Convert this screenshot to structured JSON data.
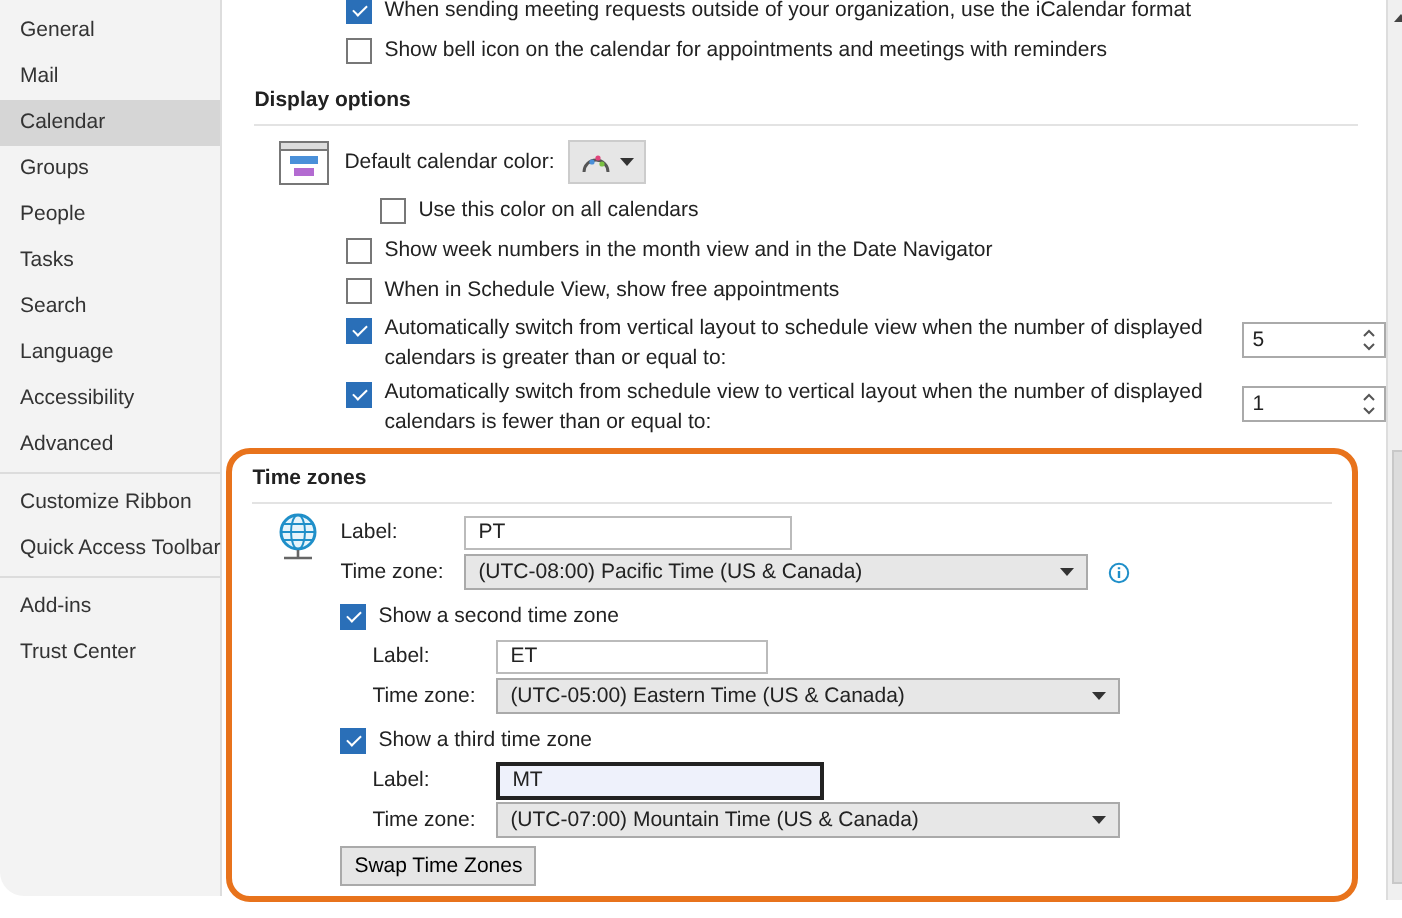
{
  "sidebar": {
    "groups": [
      {
        "items": [
          {
            "label": "General",
            "selected": false
          },
          {
            "label": "Mail",
            "selected": false
          },
          {
            "label": "Calendar",
            "selected": true
          },
          {
            "label": "Groups",
            "selected": false
          },
          {
            "label": "People",
            "selected": false
          },
          {
            "label": "Tasks",
            "selected": false
          },
          {
            "label": "Search",
            "selected": false
          },
          {
            "label": "Language",
            "selected": false
          },
          {
            "label": "Accessibility",
            "selected": false
          },
          {
            "label": "Advanced",
            "selected": false
          }
        ]
      },
      {
        "items": [
          {
            "label": "Customize Ribbon",
            "selected": false
          },
          {
            "label": "Quick Access Toolbar",
            "selected": false
          }
        ]
      },
      {
        "items": [
          {
            "label": "Add-ins",
            "selected": false
          },
          {
            "label": "Trust Center",
            "selected": false
          }
        ]
      }
    ]
  },
  "top_options": [
    {
      "label": "When sending meeting requests outside of your organization, use the iCalendar format",
      "checked": true
    },
    {
      "label": "Show bell icon on the calendar for appointments and meetings with reminders",
      "checked": false
    }
  ],
  "display_options": {
    "heading": "Display options",
    "color_label": "Default calendar color:",
    "use_color": {
      "label": "Use this color on all calendars",
      "checked": false
    },
    "options": [
      {
        "kind": "check",
        "label": "Show week numbers in the month view and in the Date Navigator",
        "checked": false
      },
      {
        "kind": "check",
        "label": "When in Schedule View, show free appointments",
        "checked": false
      },
      {
        "kind": "spin",
        "label": "Automatically switch from vertical layout to schedule view when the number of displayed calendars is greater than or equal to:",
        "checked": true,
        "value": "5"
      },
      {
        "kind": "spin",
        "label": "Automatically switch from schedule view to vertical layout when the number of displayed calendars is fewer than or equal to:",
        "checked": true,
        "value": "1"
      }
    ]
  },
  "time_zones": {
    "heading": "Time zones",
    "primary": {
      "label_caption": "Label:",
      "label_value": "PT",
      "zone_caption": "Time zone:",
      "zone_value": "(UTC-08:00) Pacific Time (US & Canada)"
    },
    "extra": [
      {
        "caption": "Show a second time zone",
        "checked": true,
        "label_caption": "Label:",
        "label_value": "ET",
        "focused": false,
        "zone_caption": "Time zone:",
        "zone_value": "(UTC-05:00) Eastern Time (US & Canada)"
      },
      {
        "caption": "Show a third time zone",
        "checked": true,
        "label_caption": "Label:",
        "label_value": "MT",
        "focused": true,
        "zone_caption": "Time zone:",
        "zone_value": "(UTC-07:00) Mountain Time (US & Canada)"
      }
    ],
    "swap_button": "Swap Time Zones"
  }
}
